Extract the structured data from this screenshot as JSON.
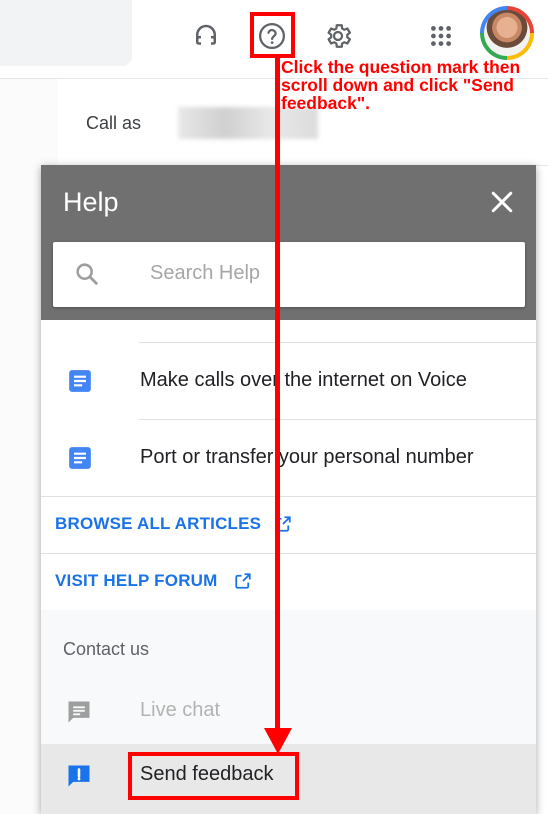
{
  "topbar": {
    "icons": [
      "headset-icon",
      "help-icon",
      "settings-icon",
      "apps-icon"
    ],
    "avatar": "account-avatar"
  },
  "call_as": {
    "label": "Call as"
  },
  "help_panel": {
    "title": "Help",
    "search_placeholder": "Search Help",
    "articles": [
      {
        "label": "Make calls over the internet on Voice"
      },
      {
        "label": "Port or transfer your personal number"
      }
    ],
    "links": [
      {
        "label": "BROWSE ALL ARTICLES"
      },
      {
        "label": "VISIT HELP FORUM"
      }
    ],
    "contact": {
      "title": "Contact us",
      "items": [
        {
          "label": "Live chat",
          "disabled": true
        },
        {
          "label": "Send feedback",
          "disabled": false
        }
      ]
    }
  },
  "annotation": {
    "text": "Click the question mark then scroll down and click \"Send feedback\"."
  },
  "colors": {
    "link_blue": "#1a73e8",
    "header_gray": "#707070",
    "annotation_red": "#ff0000",
    "doc_icon_blue": "#4285f4"
  }
}
